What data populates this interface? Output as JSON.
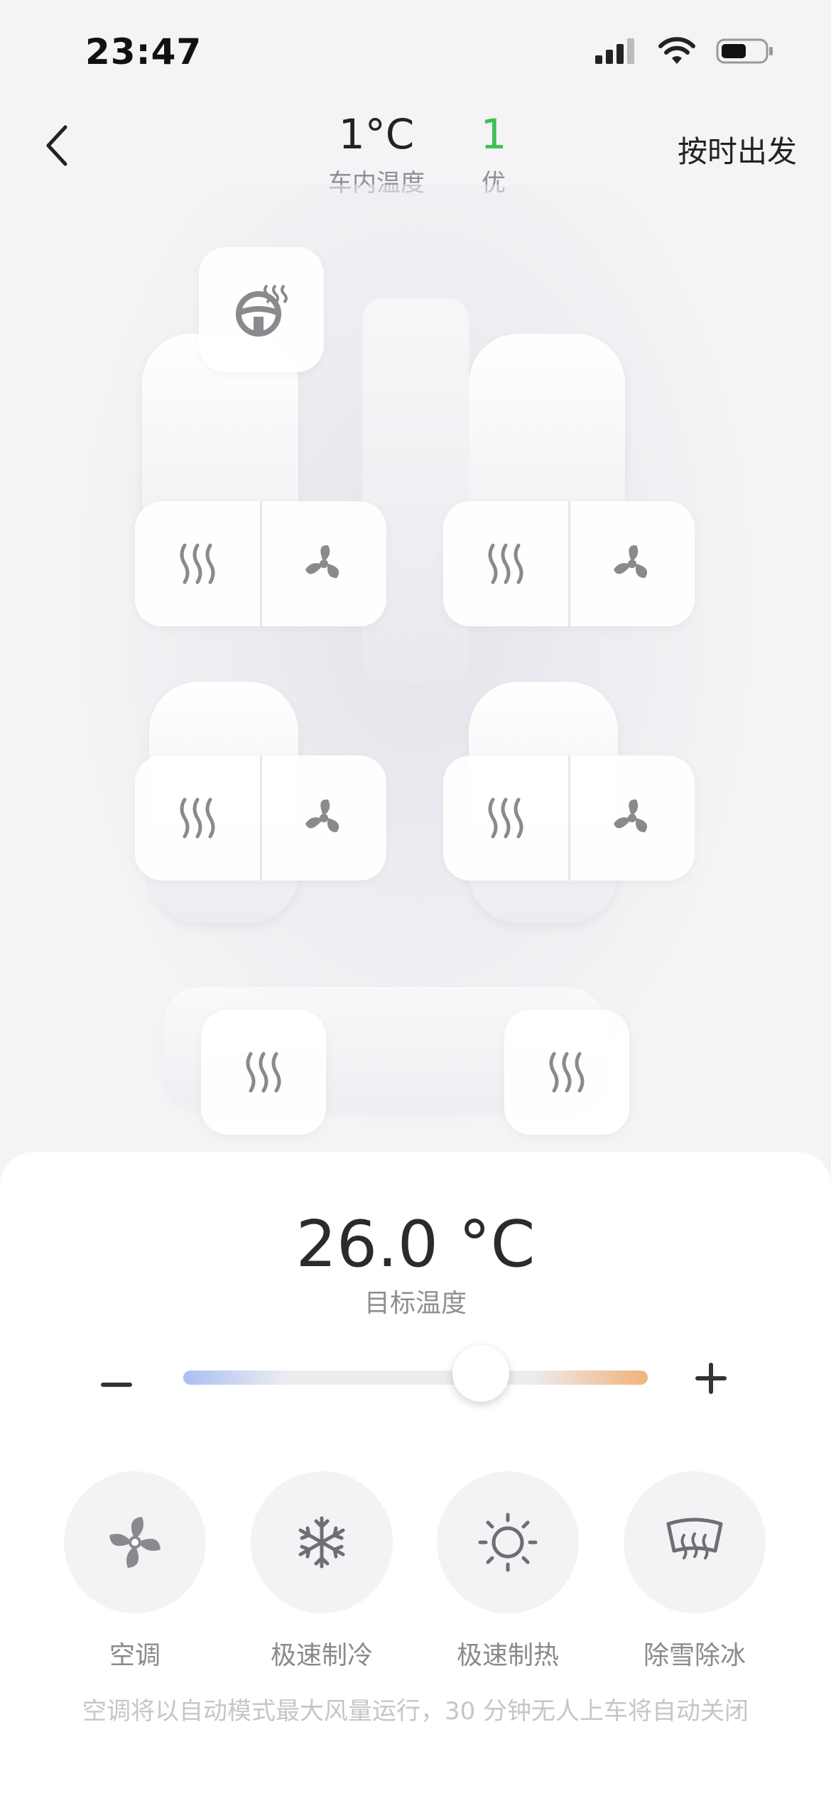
{
  "status_bar": {
    "time": "23:47"
  },
  "header": {
    "cabin_temp_value": "1°C",
    "cabin_temp_label": "车内温度",
    "air_quality_value": "1",
    "air_quality_label": "优",
    "schedule_label": "按时出发"
  },
  "seat_controls": {
    "steering_wheel": {
      "icon": "steering-wheel-heat-icon"
    },
    "seats": [
      {
        "id": "front-left",
        "heat_icon": "seat-heat-icon",
        "vent_icon": "seat-ventilation-icon"
      },
      {
        "id": "front-right",
        "heat_icon": "seat-heat-icon",
        "vent_icon": "seat-ventilation-icon"
      },
      {
        "id": "rear-left",
        "heat_icon": "seat-heat-icon",
        "vent_icon": "seat-ventilation-icon"
      },
      {
        "id": "rear-right",
        "heat_icon": "seat-heat-icon",
        "vent_icon": "seat-ventilation-icon"
      }
    ],
    "third_row": [
      {
        "id": "third-left",
        "heat_icon": "seat-heat-icon"
      },
      {
        "id": "third-right",
        "heat_icon": "seat-heat-icon"
      }
    ]
  },
  "climate": {
    "target_temp": "26.0 °C",
    "target_label": "目标温度",
    "slider_level": 0.64,
    "colors": {
      "cold": "#a9bff2",
      "hot": "#f2b27a",
      "good": "#3dbf55"
    }
  },
  "modes": [
    {
      "label": "空调",
      "icon": "fan-icon"
    },
    {
      "label": "极速制冷",
      "icon": "snowflake-icon"
    },
    {
      "label": "极速制热",
      "icon": "sun-icon"
    },
    {
      "label": "除雪除冰",
      "icon": "defrost-icon"
    }
  ],
  "footnote": "空调将以自动模式最大风量运行，30 分钟无人上车将自动关闭"
}
